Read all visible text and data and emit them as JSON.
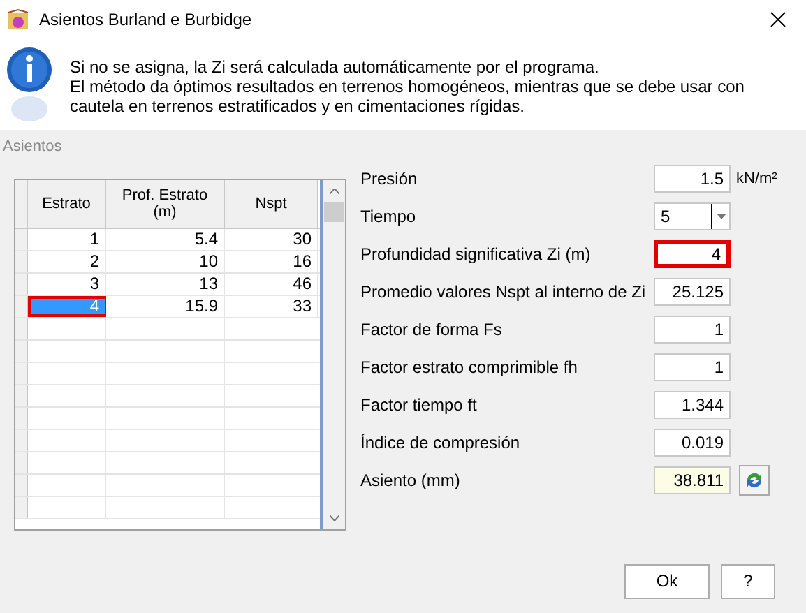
{
  "window": {
    "title": "Asientos Burland e Burbidge"
  },
  "info": {
    "lines": [
      "Si no se asigna, la Zi será calculada automáticamente por el programa.",
      "El método da óptimos resultados en terrenos homogéneos, mientras que se debe usar con cautela en terrenos estratificados y en cimentaciones rígidas."
    ]
  },
  "group": {
    "label": "Asientos"
  },
  "table": {
    "columns": [
      "Estrato",
      "Prof. Estrato (m)",
      "Nspt"
    ],
    "rows": [
      {
        "cells": [
          "1",
          "5.4",
          "30"
        ],
        "selected": false,
        "highlighted": false
      },
      {
        "cells": [
          "2",
          "10",
          "16"
        ],
        "selected": false,
        "highlighted": false
      },
      {
        "cells": [
          "3",
          "13",
          "46"
        ],
        "selected": false,
        "highlighted": false
      },
      {
        "cells": [
          "4",
          "15.9",
          "33"
        ],
        "selected": true,
        "highlighted": true
      }
    ]
  },
  "fields": [
    {
      "kind": "text",
      "label": "Presión",
      "value": "1.5",
      "unit": "kN/m²",
      "highlighted": false
    },
    {
      "kind": "dropdown",
      "label": "Tiempo",
      "value": "5",
      "highlighted": false
    },
    {
      "kind": "text",
      "label": "Profundidad significativa Zi (m)",
      "value": "4",
      "highlighted": true
    },
    {
      "kind": "text",
      "label": "Promedio valores Nspt al interno de Zi",
      "value": "25.125",
      "highlighted": false
    },
    {
      "kind": "text",
      "label": "Factor de forma Fs",
      "value": "1",
      "highlighted": false
    },
    {
      "kind": "text",
      "label": "Factor estrato comprimible fh",
      "value": "1",
      "highlighted": false
    },
    {
      "kind": "text",
      "label": "Factor tiempo ft",
      "value": "1.344",
      "highlighted": false
    },
    {
      "kind": "text",
      "label": "Índice de compresión",
      "value": "0.019",
      "highlighted": false
    },
    {
      "kind": "result",
      "label": "Asiento (mm)",
      "value": "38.811",
      "highlighted": false
    }
  ],
  "buttons": [
    "Ok",
    "?"
  ]
}
